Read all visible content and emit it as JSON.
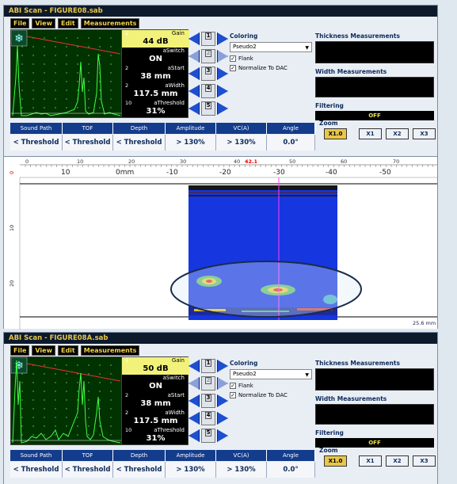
{
  "windows": [
    {
      "title": "ABI Scan - FIGURE08.sab",
      "gain": "44 dB"
    },
    {
      "title": "ABI Scan - FIGURE08A.sab",
      "gain": "50 dB"
    }
  ],
  "menu": [
    "File",
    "View",
    "Edit",
    "Measurements"
  ],
  "params": [
    {
      "num": "1",
      "label": "Gain"
    },
    {
      "num": "",
      "label": "aSwitch",
      "value": "ON"
    },
    {
      "num": "2",
      "label": "aStart",
      "value": "38 mm"
    },
    {
      "num": "2",
      "label": "aWidth",
      "value": "117.5 mm"
    },
    {
      "num": "10",
      "label": "aThreshold",
      "value": "31%"
    }
  ],
  "ctrl_nums": [
    "1",
    "2",
    "3",
    "4",
    "5"
  ],
  "coloring": {
    "label": "Coloring",
    "palette": "Pseudo2",
    "flank": "Flank",
    "normalize": "Normalize To DAC"
  },
  "right": {
    "thickness": "Thickness Measurements",
    "width": "Width Measurements",
    "filtering": "Filtering",
    "filter_value": "OFF"
  },
  "zoom": {
    "label": "Zoom",
    "buttons": [
      "X1.0",
      "X1",
      "X2",
      "X3"
    ]
  },
  "meas_headers": [
    "Sound Path",
    "TOF",
    "Depth",
    "Amplitude",
    "VC(A)",
    "Angle"
  ],
  "meas_values": [
    "< Threshold",
    "< Threshold",
    "< Threshold",
    "> 130%",
    "> 130%",
    "0.0°"
  ],
  "bscan": {
    "top_ticks": [
      "0",
      "10",
      "20",
      "30",
      "40",
      "50",
      "60",
      "70"
    ],
    "marker": "42.1",
    "sec_ticks": [
      "10",
      "0mm",
      "-10",
      "-20",
      "-30",
      "-40",
      "-50"
    ],
    "left_ticks": [
      "0",
      "10",
      "20"
    ],
    "depth_label": "25.6 mm"
  },
  "colors": {
    "title_bg": "#0d1a2c",
    "title_fg": "#e8c64a",
    "header_bg": "#143c8c",
    "highlight": "#f2f27a",
    "bscan_blue": "#1636e0"
  }
}
